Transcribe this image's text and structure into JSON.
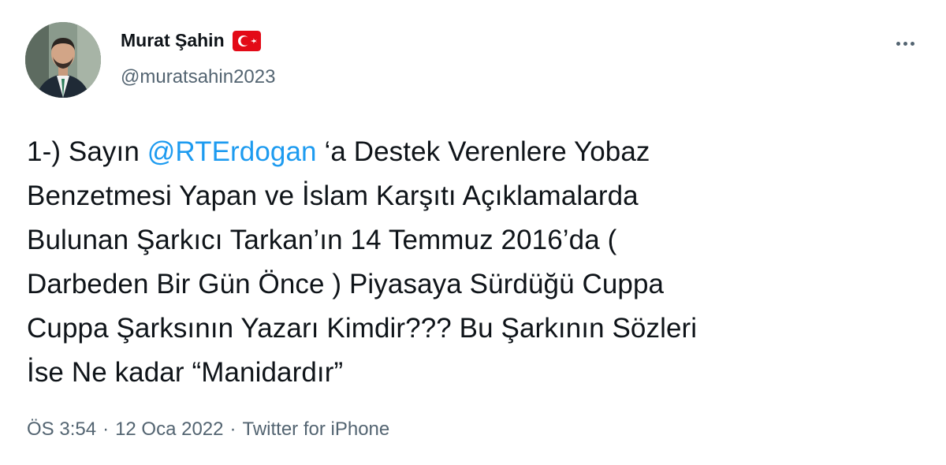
{
  "author": {
    "display_name": "Murat Şahin",
    "handle": "@muratsahin2023",
    "flag_icon": "turkey-flag-icon"
  },
  "tweet": {
    "text_lines": [
      {
        "before": "1-) Sayın ",
        "mention": "@RTErdogan",
        "after": " ‘a Destek Verenlere Yobaz"
      },
      {
        "text": "Benzetmesi Yapan ve İslam Karşıtı Açıklamalarda"
      },
      {
        "text": "Bulunan Şarkıcı Tarkan’ın 14 Temmuz 2016’da ("
      },
      {
        "text": "Darbeden Bir Gün Önce ) Piyasaya Sürdüğü Cuppa"
      },
      {
        "text": "Cuppa Şarksının Yazarı Kimdir??? Bu Şarkının Sözleri"
      },
      {
        "text": "İse Ne kadar “Manidardır”"
      }
    ]
  },
  "meta": {
    "time": "ÖS 3:54",
    "separator": "·",
    "date": "12 Oca 2022",
    "source": "Twitter for iPhone"
  },
  "colors": {
    "mention": "#1d9bf0",
    "secondary_text": "#536471",
    "primary_text": "#0f1419",
    "flag_red": "#e30a17"
  }
}
